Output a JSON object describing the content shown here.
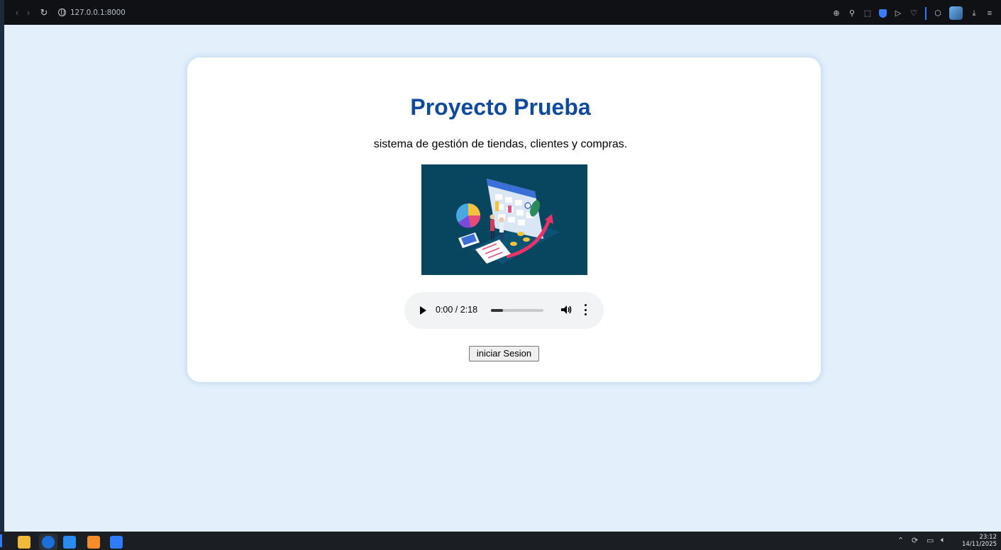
{
  "browser": {
    "url": "127.0.0.1:8000",
    "icons": [
      "back-icon",
      "forward-icon",
      "reload-icon",
      "globe-icon",
      "zoom-icon",
      "pin-icon",
      "screenshot-icon",
      "shield-icon",
      "play-icon",
      "heart-icon",
      "extensions-icon",
      "profile-avatar",
      "download-icon",
      "menu-icon"
    ]
  },
  "page": {
    "title": "Proyecto Prueba",
    "subtitle": "sistema de gestión de tiendas, clientes y compras.",
    "image": "analytics-illustration",
    "audio": {
      "time": "0:00 / 2:18",
      "progress_fraction": 0.23
    },
    "login_button": "iniciar Sesion"
  },
  "taskbar": {
    "apps": [
      "file-explorer-icon",
      "browser-app-icon",
      "vscode-icon",
      "xampp-icon",
      "docs-icon"
    ],
    "tray": [
      "chevron-up-icon",
      "sync-icon",
      "monitor-icon",
      "speaker-icon"
    ],
    "time": "23:12",
    "date": "14/11/2025"
  },
  "colors": {
    "title": "#0f4a9c",
    "background": "#e3f0fb",
    "card": "#ffffff",
    "hero_bg": "#08455f"
  }
}
